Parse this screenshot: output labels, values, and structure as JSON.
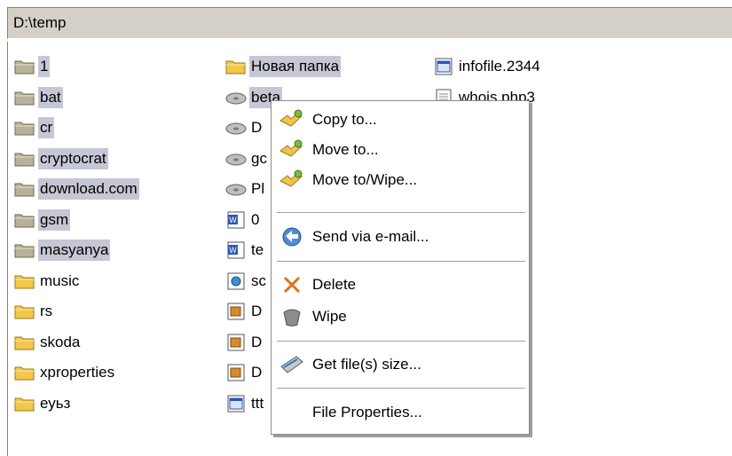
{
  "path": "D:\\temp",
  "col1": [
    {
      "name": "1",
      "selected": true
    },
    {
      "name": "bat",
      "selected": true
    },
    {
      "name": "cr",
      "selected": true
    },
    {
      "name": "cryptocrat",
      "selected": true
    },
    {
      "name": "download.com",
      "selected": true
    },
    {
      "name": "gsm",
      "selected": true
    },
    {
      "name": "masyanya",
      "selected": true
    },
    {
      "name": "music",
      "selected": false
    },
    {
      "name": "rs",
      "selected": false
    },
    {
      "name": "skoda",
      "selected": false
    },
    {
      "name": "xproperties",
      "selected": false
    },
    {
      "name": "еуьз",
      "selected": false
    }
  ],
  "col2": [
    {
      "name": "Новая папка",
      "icon": "folder-icon",
      "selected": true
    },
    {
      "name": "beta",
      "icon": "disk-image-icon",
      "selected": true
    },
    {
      "name": "D",
      "icon": "disk-image-icon",
      "selected": false
    },
    {
      "name": "gc",
      "icon": "disk-image-icon",
      "selected": false
    },
    {
      "name": "Pl",
      "icon": "disk-image-icon",
      "selected": false
    },
    {
      "name": "0",
      "icon": "word-document-icon",
      "selected": false
    },
    {
      "name": "te",
      "icon": "word-document-icon",
      "selected": false
    },
    {
      "name": "sc",
      "icon": "web-file-icon",
      "selected": false
    },
    {
      "name": "D",
      "icon": "archive-file-icon",
      "selected": false
    },
    {
      "name": "D",
      "icon": "archive-file-icon",
      "selected": false
    },
    {
      "name": "D",
      "icon": "archive-file-icon",
      "selected": false
    },
    {
      "name": "ttt",
      "icon": "generic-file-icon",
      "selected": false
    }
  ],
  "col3": [
    {
      "name": "infofile.2344",
      "icon": "generic-file-icon",
      "selected": false
    },
    {
      "name": "whois.php3",
      "icon": "text-file-icon",
      "selected": false
    }
  ],
  "menu": {
    "copy_to": "Copy to...",
    "move_to": "Move to...",
    "move_wipe": "Move to/Wipe...",
    "send_email": "Send via e-mail...",
    "delete": "Delete",
    "wipe": "Wipe",
    "get_size": "Get file(s) size...",
    "properties": "File Properties..."
  },
  "colors": {
    "selection": "#c6c7d5",
    "folder_closed": "#b7b39a",
    "folder_open": "#f3c84a",
    "delete_x": "#e07020"
  }
}
